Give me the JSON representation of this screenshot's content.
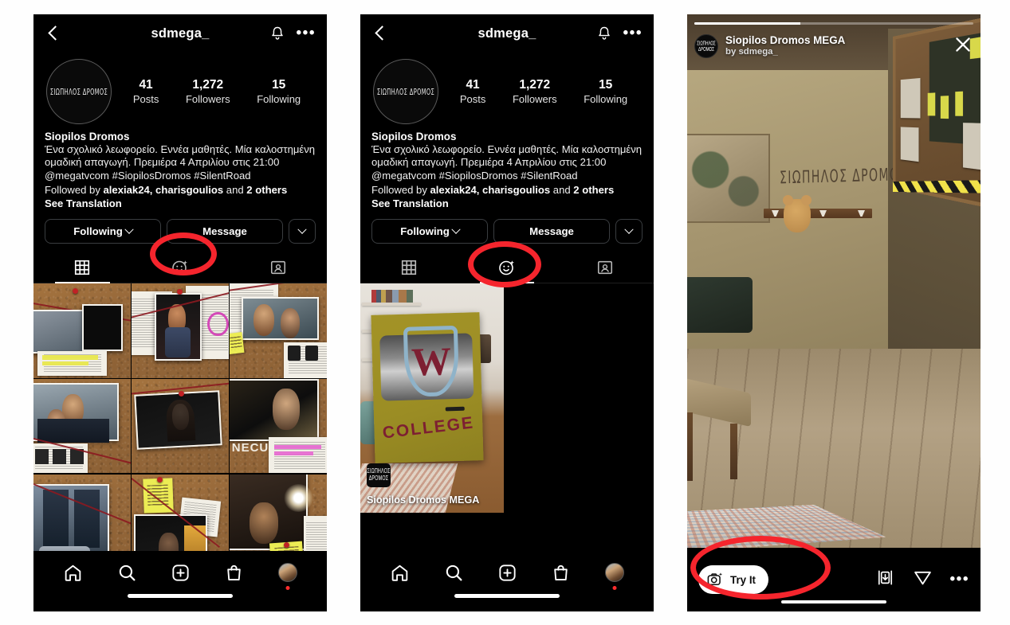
{
  "app": "Instagram",
  "profile": {
    "username": "sdmega_",
    "avatar_logo": "ΣΙΩΠΗΛΟΣ ΔΡΟΜΟΣ",
    "stats": [
      {
        "num": "41",
        "label": "Posts"
      },
      {
        "num": "1,272",
        "label": "Followers"
      },
      {
        "num": "15",
        "label": "Following"
      }
    ],
    "bio": {
      "display_name": "Siopilos Dromos",
      "line1": "Ένα σχολικό λεωφορείο. Εννέα μαθητές. Μία καλοστημένη",
      "line2": "ομαδική απαγωγή. Πρεμιέρα 4 Απριλίου στις 21:00",
      "line3": "@megatvcom #SiopilosDromos #SilentRoad",
      "followed_prefix": "Followed by ",
      "followed_names": "alexiak24, charisgoulios",
      "followed_mid": " and ",
      "followed_count": "2 others",
      "translate": "See Translation"
    },
    "actions": {
      "following": "Following",
      "message": "Message",
      "caret": "chevron-down"
    },
    "tabs": [
      {
        "name": "grid-tab",
        "icon": "grid-icon",
        "active_panel1": true
      },
      {
        "name": "effects-tab",
        "icon": "smiley-sparkle-icon",
        "active_panel2": true
      },
      {
        "name": "tagged-tab",
        "icon": "tagged-person-icon"
      }
    ],
    "topbar": {
      "back": "back-chevron",
      "bell": "notifications-bell-icon",
      "more": "more-options-icon"
    }
  },
  "bottom_nav": {
    "items": [
      {
        "name": "nav-home",
        "icon": "home-icon"
      },
      {
        "name": "nav-search",
        "icon": "search-icon"
      },
      {
        "name": "nav-create",
        "icon": "plus-box-icon"
      },
      {
        "name": "nav-shop",
        "icon": "shopping-bag-icon"
      },
      {
        "name": "nav-profile",
        "icon": "profile-avatar-icon",
        "badge": true
      }
    ]
  },
  "effects_tab": {
    "card": {
      "label": "Siopilos Dromos MEGA",
      "badge_logo": "ΣΙΩΠΗΛΟΣ ΔΡΟΜΟΣ",
      "overlay_letter": "W",
      "overlay_word": "COLLEGE"
    }
  },
  "story": {
    "progress_percent": 38,
    "avatar_logo": "ΣΙΩΠΗΛΟΣ ΔΡΟΜΟΣ",
    "title": "Siopilos Dromos MEGA",
    "subtitle": "by sdmega_",
    "close": "close-icon",
    "wall_text": "ΣΙΩΠΗΛΟΣ ΔΡΟΜΟΣ",
    "try_it": "Try It",
    "try_it_icon": "camera-sparkle-icon",
    "actions": [
      {
        "name": "save-effect-button",
        "icon": "download-box-icon"
      },
      {
        "name": "share-effect-button",
        "icon": "send-paper-plane-icon"
      },
      {
        "name": "more-options-button",
        "icon": "more-dots-icon"
      }
    ]
  },
  "annotations": {
    "color": "#f5252d",
    "marks": [
      {
        "name": "annotation-effects-tab-panel1",
        "target": "effects-tab"
      },
      {
        "name": "annotation-effects-tab-panel2",
        "target": "effects-tab"
      },
      {
        "name": "annotation-try-it-button",
        "target": "try-it-button"
      }
    ]
  }
}
